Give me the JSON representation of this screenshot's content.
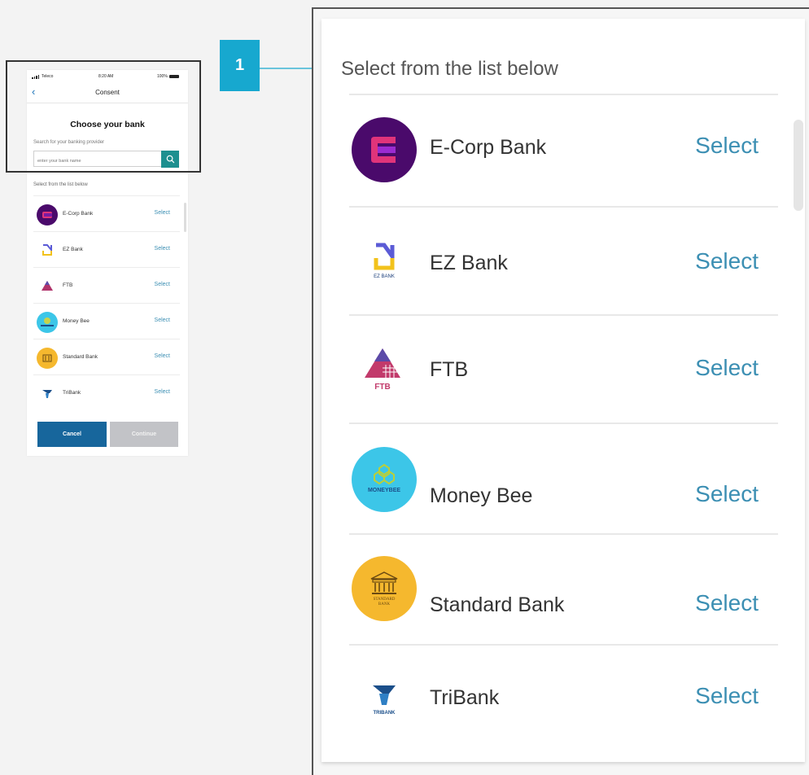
{
  "phone": {
    "status": {
      "carrier": "Teleco",
      "time": "8:20 AM",
      "battery": "100%"
    },
    "nav_title": "Consent",
    "heading": "Choose your bank",
    "search_label": "Search for your banking provider",
    "search_placeholder": "enter your bank name",
    "list_label": "Select from the list below",
    "banks": [
      {
        "name": "E-Corp Bank",
        "action": "Select"
      },
      {
        "name": "EZ Bank",
        "action": "Select"
      },
      {
        "name": "FTB",
        "action": "Select"
      },
      {
        "name": "Money Bee",
        "action": "Select"
      },
      {
        "name": "Standard Bank",
        "action": "Select"
      },
      {
        "name": "TriBank",
        "action": "Select"
      }
    ],
    "cancel_label": "Cancel",
    "continue_label": "Continue"
  },
  "callout": {
    "number": "1"
  },
  "zoom": {
    "list_label": "Select from the list below",
    "banks": [
      {
        "name": "E-Corp Bank",
        "action": "Select"
      },
      {
        "name": "EZ Bank",
        "action": "Select"
      },
      {
        "name": "FTB",
        "action": "Select"
      },
      {
        "name": "Money Bee",
        "action": "Select"
      },
      {
        "name": "Standard Bank",
        "action": "Select"
      },
      {
        "name": "TriBank",
        "action": "Select"
      }
    ]
  },
  "logos": {
    "ez_text": "EZ BANK",
    "ftb_text": "FTB",
    "moneybee_text": "MONEYBEE",
    "standard_text_1": "STANDARD",
    "standard_text_2": "BANK",
    "tribank_text": "TRIBANK"
  },
  "colors": {
    "accent": "#17a8cf",
    "select_link": "#3c8fb3",
    "cancel_button": "#17669c",
    "continue_button": "#c2c3c7",
    "search_button": "#1d8f8f",
    "ecorp": "#4a0a6b",
    "moneybee": "#3cc6e8",
    "standard": "#f5b82e"
  },
  "icons": [
    "back-chevron-icon",
    "search-icon",
    "signal-icon",
    "wifi-icon",
    "battery-icon",
    "arrow-icon"
  ]
}
